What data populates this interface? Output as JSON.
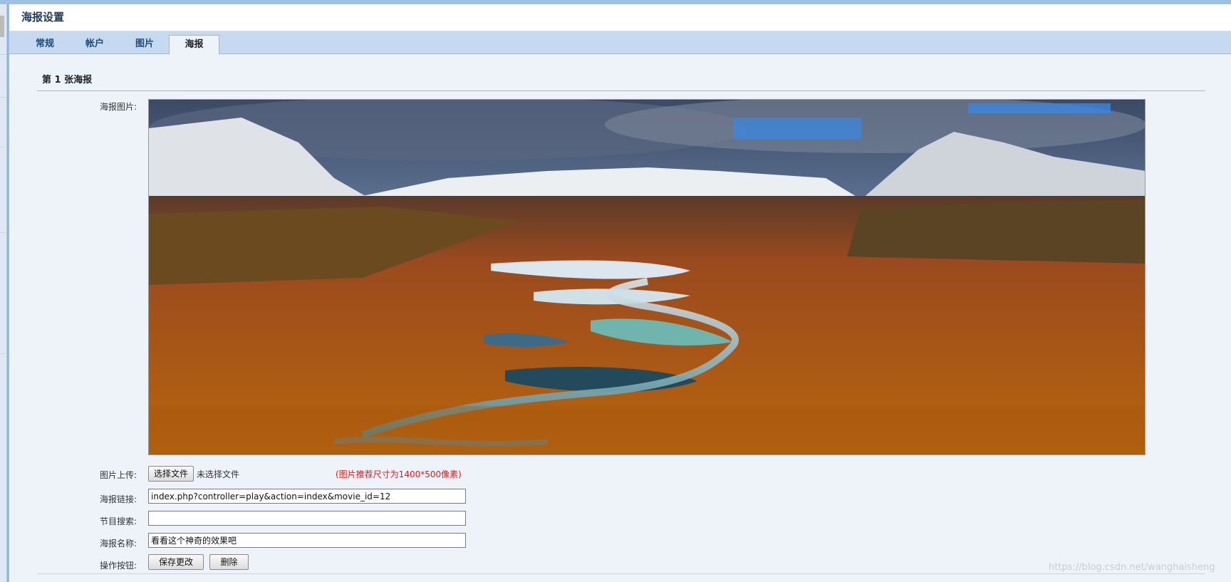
{
  "window": {
    "title": "海报设置"
  },
  "tabs": [
    {
      "label": "常规"
    },
    {
      "label": "帐户"
    },
    {
      "label": "图片"
    },
    {
      "label": "海报",
      "active": true
    }
  ],
  "section": {
    "title": "第 1 张海报"
  },
  "form": {
    "poster_image_label": "海报图片:",
    "upload_label": "图片上传:",
    "choose_file_button": "选择文件",
    "no_file_text": "未选择文件",
    "size_hint": "(图片推荐尺寸为1400*500像素)",
    "link_label": "海报链接:",
    "link_value": "index.php?controller=play&action=index&movie_id=12",
    "program_search_label": "节目搜索:",
    "program_search_value": "",
    "name_label": "海报名称:",
    "name_value": "看看这个神奇的效果吧",
    "actions_label": "操作按钮:",
    "save_button": "保存更改",
    "delete_button": "删除"
  },
  "watermark": "https://blog.csdn.net/wanghaisheng",
  "colors": {
    "tab_bar": "#c5d9f1",
    "panel_bg": "#eef3fa",
    "hint_red": "#e01818"
  }
}
